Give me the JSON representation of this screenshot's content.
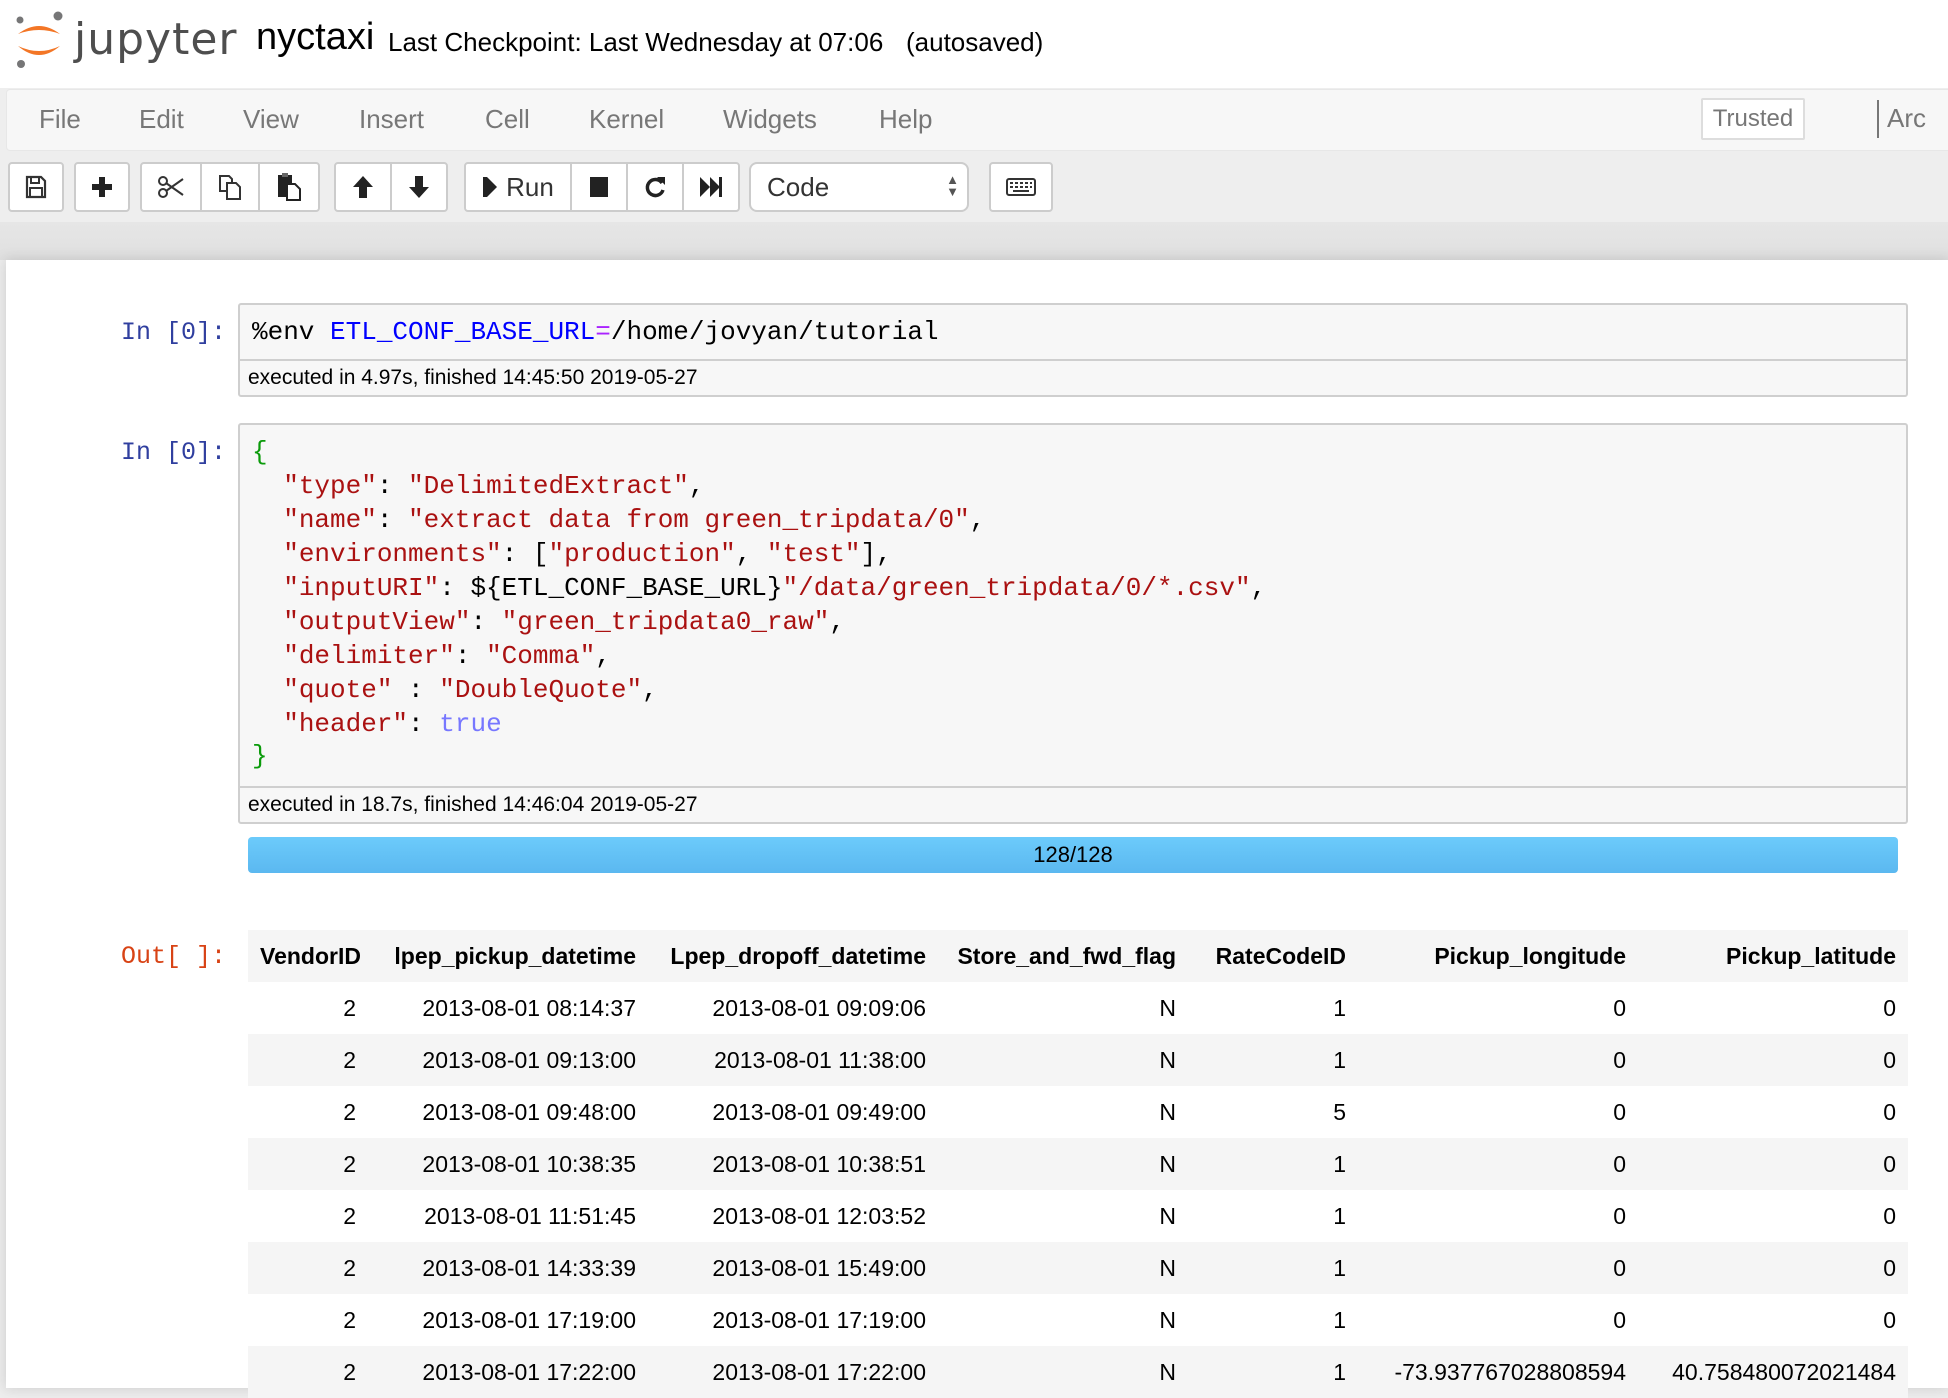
{
  "header": {
    "logo_text": "jupyter",
    "notebook_name": "nyctaxi",
    "checkpoint": "Last Checkpoint: Last Wednesday at 07:06",
    "autosave_status": "(autosaved)"
  },
  "menubar": {
    "items": [
      "File",
      "Edit",
      "View",
      "Insert",
      "Cell",
      "Kernel",
      "Widgets",
      "Help"
    ],
    "trusted_label": "Trusted",
    "kernel_name": "Arc"
  },
  "toolbar": {
    "run_label": "Run",
    "cell_type": "Code",
    "icons": [
      "save-icon",
      "plus-icon",
      "cut-icon",
      "copy-icon",
      "paste-icon",
      "arrow-up-icon",
      "arrow-down-icon",
      "step-forward-icon",
      "stop-icon",
      "restart-icon",
      "fast-forward-icon",
      "keyboard-icon"
    ]
  },
  "cells": [
    {
      "prompt": "In [0]:",
      "code": {
        "magic": "%env ",
        "var": "ETL_CONF_BASE_URL",
        "op": "=",
        "value": "/home/jovyan/tutorial"
      },
      "exec_info": "executed in 4.97s, finished 14:45:50 2019-05-27"
    },
    {
      "prompt": "In [0]:",
      "code_lines": [
        {
          "key": "\"type\"",
          "sep": ": ",
          "value": "\"DelimitedExtract\"",
          "tail": ","
        },
        {
          "key": "\"name\"",
          "sep": ": ",
          "value": "\"extract data from green_tripdata/0\"",
          "tail": ","
        },
        {
          "key": "\"environments\"",
          "sep": ": [",
          "value": "\"production\"",
          "mid": ", ",
          "value2": "\"test\"",
          "tail": "],"
        },
        {
          "key": "\"inputURI\"",
          "sep": ": ${ETL_CONF_BASE_URL}",
          "value": "\"/data/green_tripdata/0/*.csv\"",
          "tail": ","
        },
        {
          "key": "\"outputView\"",
          "sep": ": ",
          "value": "\"green_tripdata0_raw\"",
          "tail": ","
        },
        {
          "key": "\"delimiter\"",
          "sep": ": ",
          "value": "\"Comma\"",
          "tail": ","
        },
        {
          "key": "\"quote\"",
          "sep": " : ",
          "value": "\"DoubleQuote\"",
          "tail": ","
        },
        {
          "key": "\"header\"",
          "sep": ": ",
          "bool": "true",
          "tail": ""
        }
      ],
      "open_brace": "{",
      "close_brace": "}",
      "exec_info": "executed in 18.7s, finished 14:46:04 2019-05-27",
      "progress": {
        "label": "128/128",
        "completed": 128,
        "total": 128,
        "fraction": 1.0
      },
      "output_prompt": "Out[ ]:",
      "table": {
        "columns": [
          "VendorID",
          "lpep_pickup_datetime",
          "Lpep_dropoff_datetime",
          "Store_and_fwd_flag",
          "RateCodeID",
          "Pickup_longitude",
          "Pickup_latitude"
        ],
        "rows": [
          [
            "2",
            "2013-08-01 08:14:37",
            "2013-08-01 09:09:06",
            "N",
            "1",
            "0",
            "0"
          ],
          [
            "2",
            "2013-08-01 09:13:00",
            "2013-08-01 11:38:00",
            "N",
            "1",
            "0",
            "0"
          ],
          [
            "2",
            "2013-08-01 09:48:00",
            "2013-08-01 09:49:00",
            "N",
            "5",
            "0",
            "0"
          ],
          [
            "2",
            "2013-08-01 10:38:35",
            "2013-08-01 10:38:51",
            "N",
            "1",
            "0",
            "0"
          ],
          [
            "2",
            "2013-08-01 11:51:45",
            "2013-08-01 12:03:52",
            "N",
            "1",
            "0",
            "0"
          ],
          [
            "2",
            "2013-08-01 14:33:39",
            "2013-08-01 15:49:00",
            "N",
            "1",
            "0",
            "0"
          ],
          [
            "2",
            "2013-08-01 17:19:00",
            "2013-08-01 17:19:00",
            "N",
            "1",
            "0",
            "0"
          ],
          [
            "2",
            "2013-08-01 17:22:00",
            "2013-08-01 17:22:00",
            "N",
            "1",
            "-73.937767028808594",
            "40.758480072021484"
          ]
        ]
      }
    }
  ],
  "colors": {
    "logo_orange": "#f37626",
    "prompt_in": "#303f9f",
    "prompt_out": "#d84315",
    "progress_fill": "#5bb8f0"
  }
}
